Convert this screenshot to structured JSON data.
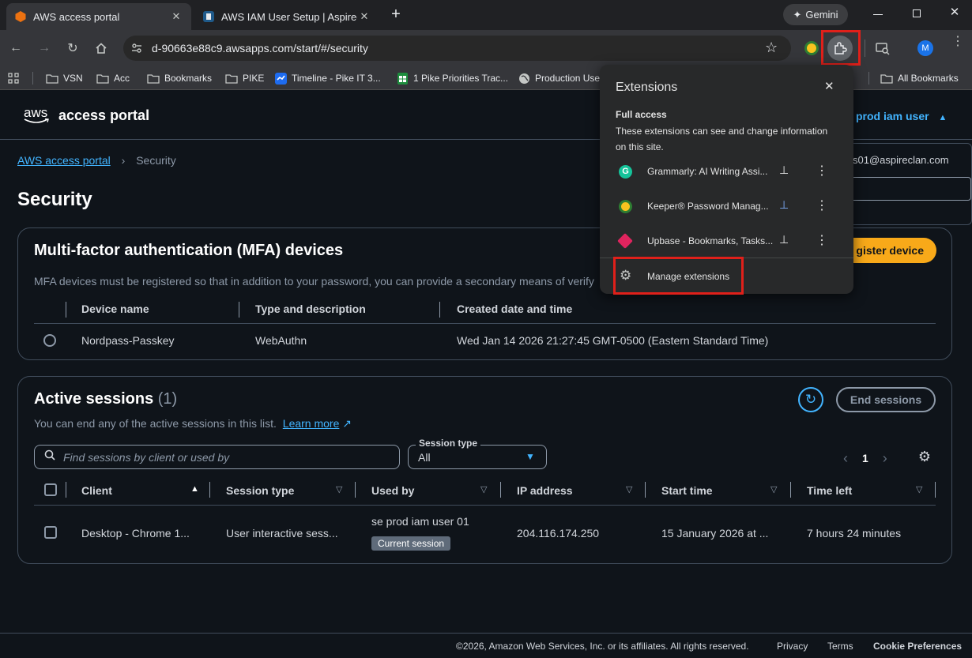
{
  "browser": {
    "tabs": [
      {
        "title": "AWS access portal",
        "active": true
      },
      {
        "title": "AWS IAM User Setup | Aspirecla",
        "active": false
      }
    ],
    "new_tab": "+",
    "gemini_label": "Gemini",
    "url": "d-90663e88c9.awsapps.com/start/#/security",
    "profile_initial": "M",
    "bookmarks": [
      "VSN",
      "Acc",
      "Bookmarks",
      "PIKE",
      "Timeline - Pike IT 3...",
      "1 Pike Priorities Trac...",
      "Production Use"
    ],
    "all_bookmarks": "All Bookmarks"
  },
  "header": {
    "logo": "aws",
    "title": "access portal",
    "user_menu": "prod iam user",
    "user_email": "s01@aspireclan.com"
  },
  "breadcrumb": {
    "root": "AWS access portal",
    "current": "Security"
  },
  "page_title": "Security",
  "mfa": {
    "title": "Multi-factor authentication (MFA) devices",
    "description": "MFA devices must be registered so that in addition to your password, you can provide a secondary means of verify",
    "register_button": "gister device",
    "columns": [
      "Device name",
      "Type and description",
      "Created date and time"
    ],
    "rows": [
      {
        "device": "Nordpass-Passkey",
        "type": "WebAuthn",
        "created": "Wed Jan 14 2026 21:27:45 GMT-0500 (Eastern Standard Time)"
      }
    ]
  },
  "sessions": {
    "title": "Active sessions",
    "count": "(1)",
    "description": "You can end any of the active sessions in this list.",
    "learn_more": "Learn more",
    "end_button": "End sessions",
    "search_placeholder": "Find sessions by client or used by",
    "session_type_label": "Session type",
    "session_type_value": "All",
    "page_number": "1",
    "columns": [
      "Client",
      "Session type",
      "Used by",
      "IP address",
      "Start time",
      "Time left"
    ],
    "rows": [
      {
        "client": "Desktop - Chrome 1...",
        "type": "User interactive sess...",
        "used_by": "se prod iam user 01",
        "badge": "Current session",
        "ip": "204.116.174.250",
        "start": "15 January 2026 at ...",
        "time_left": "7 hours 24 minutes"
      }
    ]
  },
  "footer": {
    "copyright": "©2026, Amazon Web Services, Inc. or its affiliates. All rights reserved.",
    "privacy": "Privacy",
    "terms": "Terms",
    "cookies": "Cookie Preferences"
  },
  "extensions_popup": {
    "title": "Extensions",
    "section_title": "Full access",
    "section_desc": "These extensions can see and change information on this site.",
    "items": [
      {
        "name": "Grammarly: AI Writing Assi..."
      },
      {
        "name": "Keeper® Password Manag..."
      },
      {
        "name": "Upbase - Bookmarks, Tasks..."
      }
    ],
    "manage": "Manage extensions"
  },
  "colors": {
    "accent": "#42b4ff",
    "highlight": "#e0201a",
    "register": "#f8a919"
  }
}
